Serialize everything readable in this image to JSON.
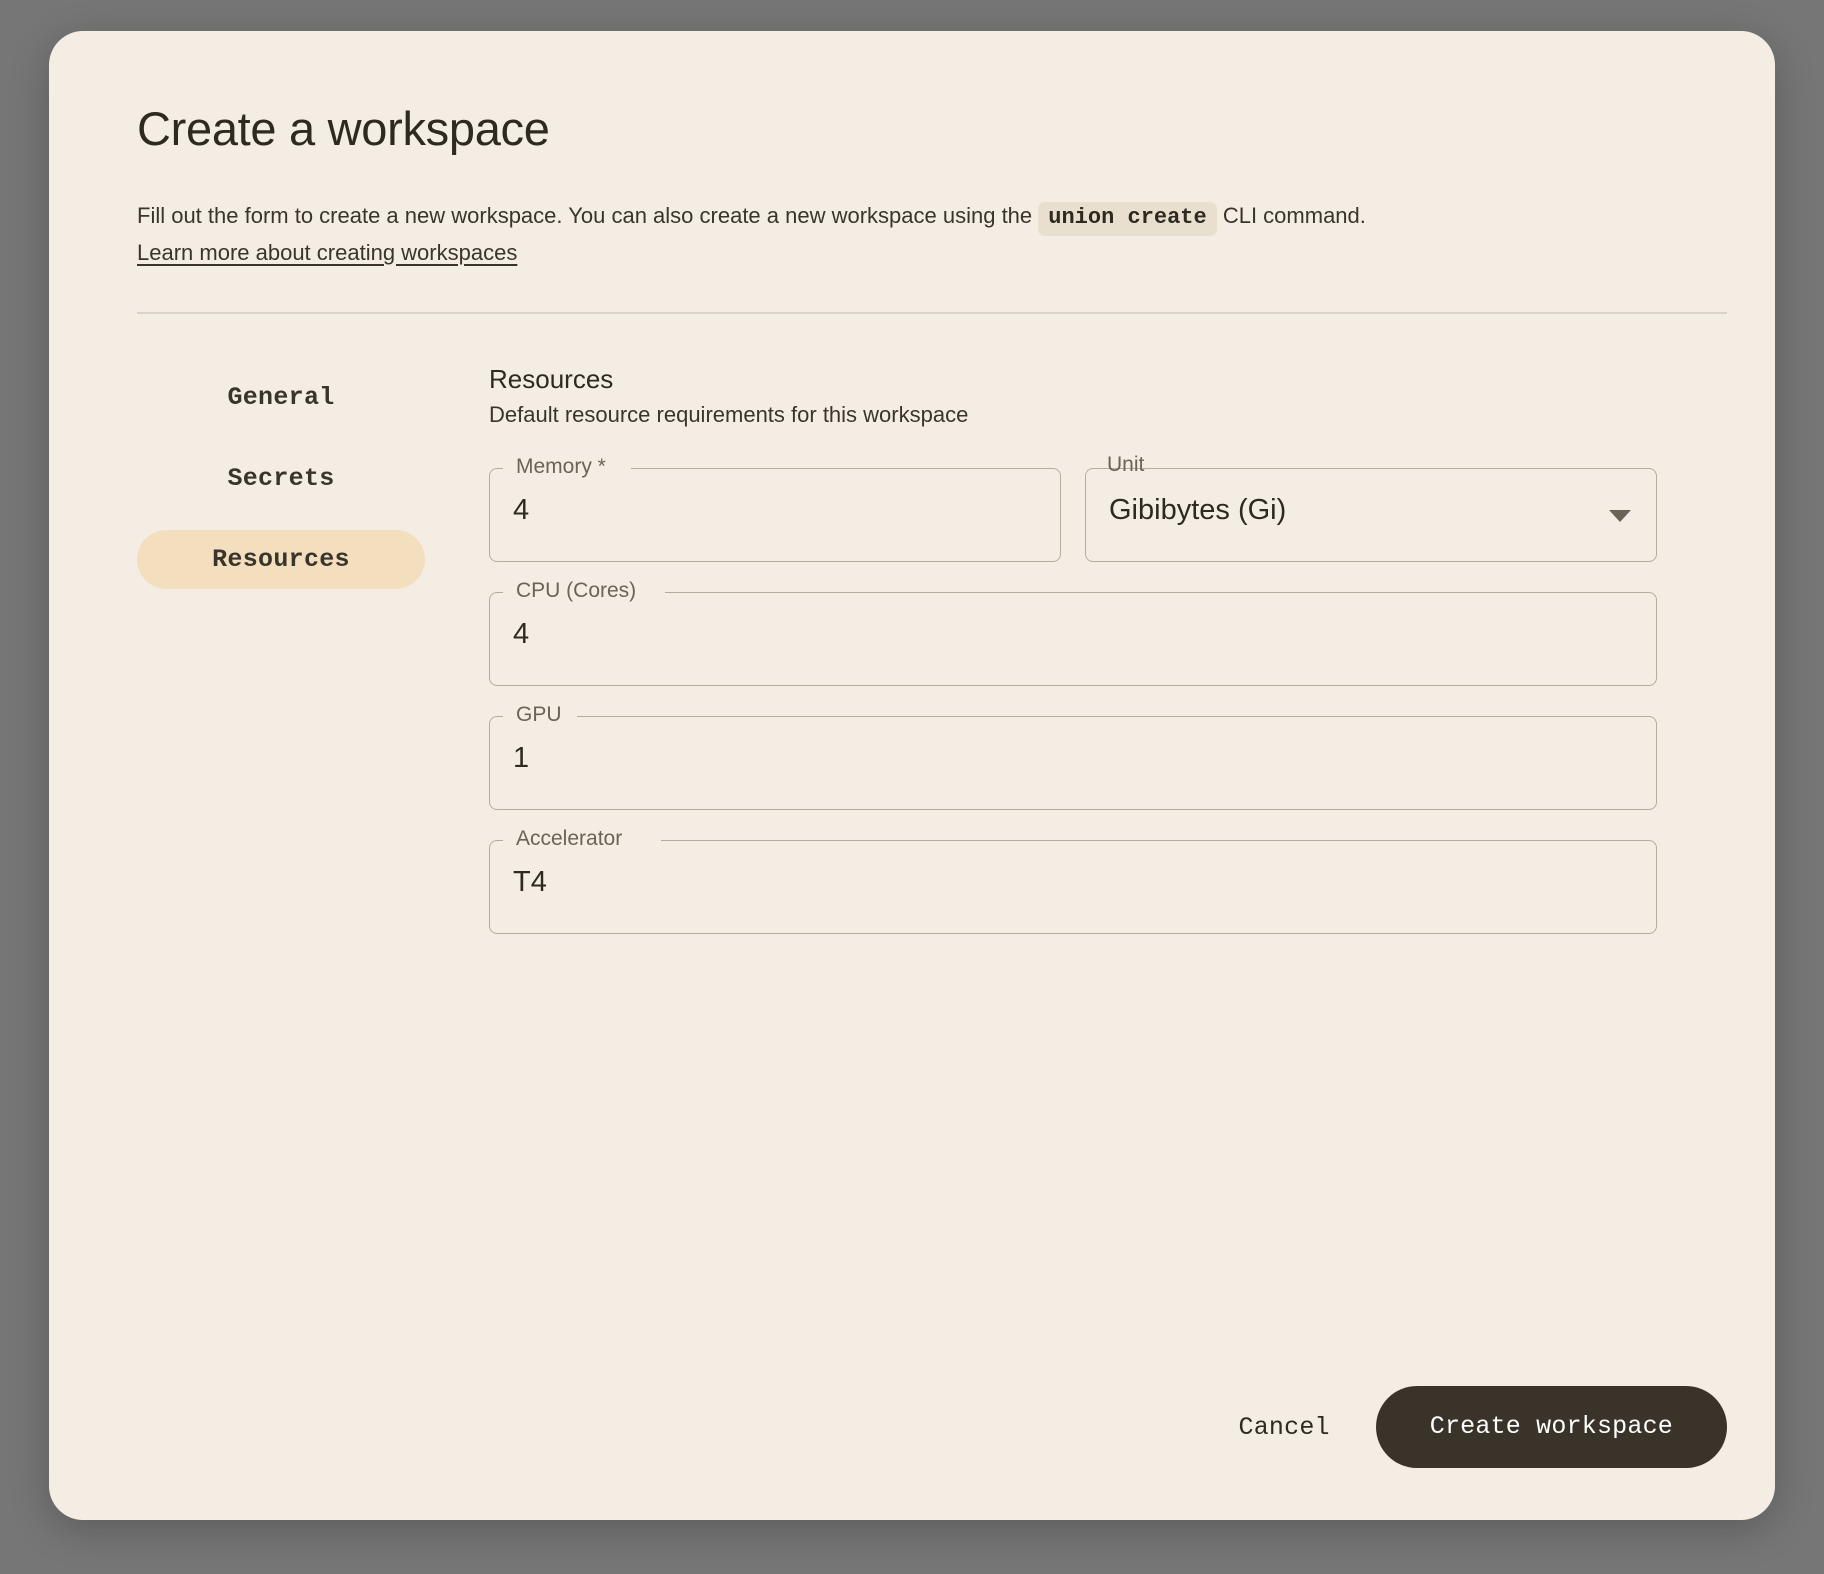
{
  "dialog": {
    "title": "Create a workspace",
    "description_before": "Fill out the form to create a new workspace. You can also create a new workspace using the ",
    "cli_command": "union create",
    "description_after": " CLI command.",
    "learn_more_link": "Learn more about creating workspaces"
  },
  "sidebar": {
    "items": [
      {
        "label": "General",
        "active": false
      },
      {
        "label": "Secrets",
        "active": false
      },
      {
        "label": "Resources",
        "active": true
      }
    ]
  },
  "section": {
    "title": "Resources",
    "subtitle": "Default resource requirements for this workspace"
  },
  "fields": {
    "memory": {
      "label": "Memory *",
      "value": "4"
    },
    "unit": {
      "label": "Unit",
      "value": "Gibibytes (Gi)"
    },
    "cpu": {
      "label": "CPU (Cores)",
      "value": "4"
    },
    "gpu": {
      "label": "GPU",
      "value": "1"
    },
    "accelerator": {
      "label": "Accelerator",
      "value": "T4"
    }
  },
  "footer": {
    "cancel_label": "Cancel",
    "create_label": "Create workspace"
  },
  "colors": {
    "dialog_bg": "#F4EDE3",
    "backdrop": "#767676",
    "accent_active": "#F3DFBE",
    "primary_button": "#3A332A",
    "text": "#2E2A22",
    "border": "#B5AC9D",
    "code_bg": "#E8DFCF"
  }
}
